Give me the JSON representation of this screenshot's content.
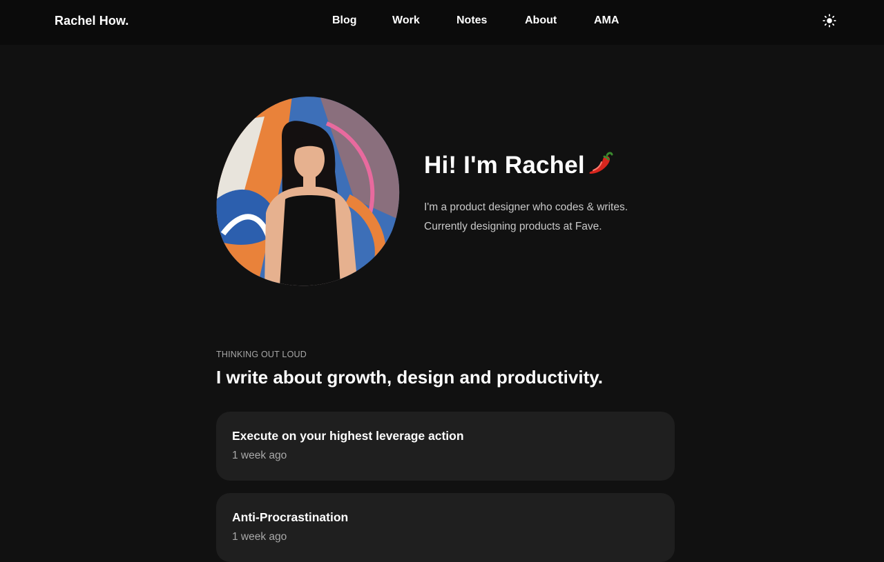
{
  "site": {
    "brand": "Rachel How.",
    "nav": [
      "Blog",
      "Work",
      "Notes",
      "About",
      "AMA"
    ],
    "theme_toggle_icon": "sun-icon"
  },
  "hero": {
    "title": "Hi! I'm Rachel",
    "emoji_icon": "chili-pepper-icon",
    "subtitle_lines": [
      "I'm a product designer who codes & writes.",
      "Currently designing products at Fave."
    ],
    "photo": "portrait-photo"
  },
  "writing": {
    "eyebrow": "THINKING OUT LOUD",
    "heading": "I write about growth, design and productivity.",
    "posts": [
      {
        "title": "Execute on your highest leverage action",
        "time": "1 week ago"
      },
      {
        "title": "Anti-Procrastination",
        "time": "1 week ago"
      }
    ]
  },
  "colors": {
    "background": "#111111",
    "nav_background": "#0b0b0b",
    "card_background": "#1f1f1f",
    "text_primary": "#ffffff",
    "text_muted": "#a9a9a9"
  }
}
